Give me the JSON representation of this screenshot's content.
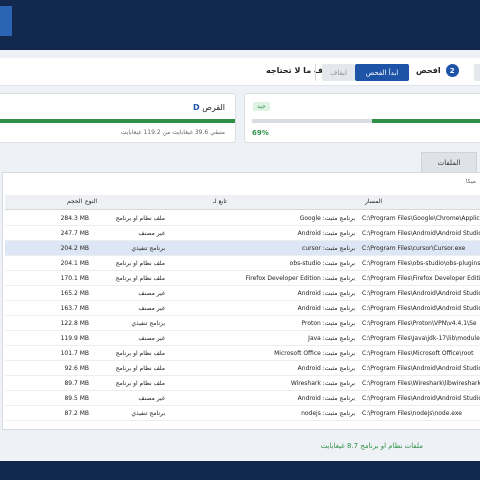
{
  "steps": {
    "step2_label": "افحص",
    "step2_num": "2",
    "step3_label": "راجع النتائج واحذف ما لا تحتاجه",
    "step3_num": "3",
    "start_button": "ابدأ الفحص",
    "stop_button": "ايقاف"
  },
  "drive_card": {
    "title": "القرص",
    "drive_letter": "D",
    "subtitle": "متبقي 39.6 غيغابايت من 119.2 غيغابايت"
  },
  "status_card": {
    "badge": "جيد",
    "percent": "69%"
  },
  "tabs": {
    "files_label": "الملفات"
  },
  "search": {
    "text": "ميكا"
  },
  "table": {
    "headers": {
      "path": "المسار",
      "vendor": "تابع لـ",
      "type": "النوع",
      "size": "الحجم"
    },
    "rows": [
      {
        "path": "C:\\Program Files\\Google\\Chrome\\Application",
        "vendor": "برنامج مثبت: Google",
        "type": "ملف نظام او برنامج",
        "size": "284.3 MB"
      },
      {
        "path": "C:\\Program Files\\Android\\Android Studio",
        "vendor": "برنامج مثبت: Android",
        "type": "غير مصنف",
        "size": "247.7 MB"
      },
      {
        "path": "C:\\Program Files\\cursor\\Cursor.exe",
        "vendor": "برنامج مثبت: cursor",
        "type": "برنامج تنفيذي",
        "size": "204.2 MB"
      },
      {
        "path": "C:\\Program Files\\obs-studio\\obs-plugins",
        "vendor": "برنامج مثبت: obs-studio",
        "type": "ملف نظام او برنامج",
        "size": "204.1 MB"
      },
      {
        "path": "C:\\Program Files\\Firefox Developer Edition",
        "vendor": "برنامج مثبت: Firefox Developer Edition",
        "type": "ملف نظام او برنامج",
        "size": "170.1 MB"
      },
      {
        "path": "C:\\Program Files\\Android\\Android Studio",
        "vendor": "برنامج مثبت: Android",
        "type": "غير مصنف",
        "size": "165.2 MB"
      },
      {
        "path": "C:\\Program Files\\Android\\Android Studio",
        "vendor": "برنامج مثبت: Android",
        "type": "غير مصنف",
        "size": "163.7 MB"
      },
      {
        "path": "C:\\Program Files\\Proton\\VPN\\v4.4.1\\Se",
        "vendor": "برنامج مثبت: Proton",
        "type": "برنامج تنفيذي",
        "size": "122.8 MB"
      },
      {
        "path": "C:\\Program Files\\Java\\jdk-17\\lib\\modules",
        "vendor": "برنامج مثبت: Java",
        "type": "غير مصنف",
        "size": "119.9 MB"
      },
      {
        "path": "C:\\Program Files\\Microsoft Office\\root",
        "vendor": "برنامج مثبت: Microsoft Office",
        "type": "ملف نظام او برنامج",
        "size": "101.7 MB"
      },
      {
        "path": "C:\\Program Files\\Android\\Android Studio",
        "vendor": "برنامج مثبت: Android",
        "type": "ملف نظام او برنامج",
        "size": "92.6 MB"
      },
      {
        "path": "C:\\Program Files\\Wireshark\\libwireshark",
        "vendor": "برنامج مثبت: Wireshark",
        "type": "ملف نظام او برنامج",
        "size": "89.7 MB"
      },
      {
        "path": "C:\\Program Files\\Android\\Android Studio",
        "vendor": "برنامج مثبت: Android",
        "type": "غير مصنف",
        "size": "89.5 MB"
      },
      {
        "path": "C:\\Program Files\\nodejs\\node.exe",
        "vendor": "برنامج مثبت: nodejs",
        "type": "برنامج تنفيذي",
        "size": "87.2 MB"
      }
    ]
  },
  "footer": {
    "summary": "ملفات نظام او برنامج 8.7 غيغابايت"
  },
  "colors": {
    "navy": "#13284d",
    "accent": "#1e54a8",
    "green": "#2f8f46"
  }
}
